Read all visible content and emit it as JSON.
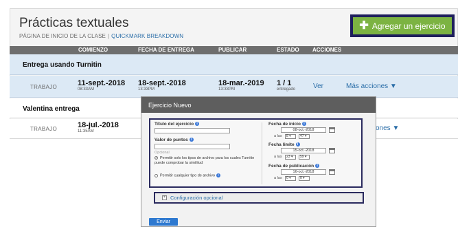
{
  "page": {
    "title": "Prácticas textuales",
    "breadcrumb": {
      "home": "PÁGINA DE INICIO DE LA CLASE",
      "separator": "|",
      "link": "QUICKMARK BREAKDOWN"
    },
    "add_button": {
      "icon": "plus-icon",
      "label": "Agregar un ejercicio",
      "color": "#7cb342"
    }
  },
  "table": {
    "headers": [
      "COMIENZO",
      "FECHA DE ENTREGA",
      "PUBLICAR",
      "ESTADO",
      "ACCIONES"
    ],
    "rows": [
      {
        "title": "Entrega usando Turnitin",
        "type": "TRABAJO",
        "start": {
          "date": "11-sept.-2018",
          "time": "08:33AM"
        },
        "due": {
          "date": "18-sept.-2018",
          "time": "13:33PM"
        },
        "publish": {
          "date": "18-mar.-2019",
          "time": "13:33PM"
        },
        "status": {
          "count": "1 / 1",
          "label": "entregado"
        },
        "view": "Ver",
        "more": "Más acciones",
        "more_icon": "caret-down-icon"
      },
      {
        "title": "Valentina entrega",
        "type": "TRABAJO",
        "start": {
          "date": "18-jul.-2018",
          "time": "11:35AM"
        },
        "more": "ones",
        "more_icon": "caret-down-icon"
      }
    ]
  },
  "modal": {
    "title": "Ejercicio Nuevo",
    "form": {
      "title_label": "Título del ejercicio",
      "points_label": "Valor de puntos",
      "optional": "Opcional",
      "radio1": "Permitir solo los tipos de archivo para los cuales Turnitin puede comprobar la similitud",
      "radio2": "Permitir cualquier tipo de archivo",
      "start_label": "Fecha de inicio",
      "start_date": "08-oct.-2018",
      "due_label": "Fecha límite",
      "due_date": "15-oct.-2018",
      "publish_label": "Fecha de publicación",
      "publish_date": "16-oct.-2018",
      "at": "a las",
      "start_hour": "8",
      "start_min": "47",
      "due_hour": "23",
      "due_min": "59",
      "publish_hour": "0",
      "publish_min": "0",
      "info_icon": "info-icon",
      "calendar_icon": "calendar-icon"
    },
    "optional_config": "Configuración opcional",
    "send_button": "Enviar"
  }
}
